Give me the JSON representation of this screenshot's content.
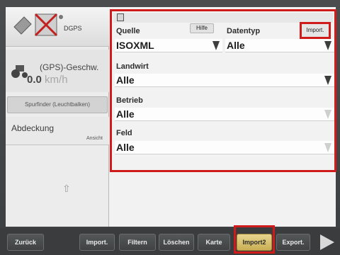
{
  "left": {
    "gps_label": "DGPS",
    "speed_title": "(GPS)-Geschw.",
    "speed_value": "0.0",
    "speed_unit": "km/h",
    "spurfinder": "Spurfinder (Leuchtbalken)",
    "abdeckung": "Abdeckung",
    "ansicht": "Ansicht"
  },
  "form": {
    "quelle_label": "Quelle",
    "quelle_value": "ISOXML",
    "hilfe_button": "Hilfe",
    "datentyp_label": "Datentyp",
    "datentyp_value": "Alle",
    "import_button": "Import.",
    "landwirt_label": "Landwirt",
    "landwirt_value": "Alle",
    "betrieb_label": "Betrieb",
    "betrieb_value": "Alle",
    "feld_label": "Feld",
    "feld_value": "Alle"
  },
  "bottom": {
    "zuruck": "Zurück",
    "import": "Import.",
    "filtern": "Filtern",
    "loschen": "Löschen",
    "karte": "Karte",
    "import2": "Import2",
    "export": "Export."
  },
  "colors": {
    "highlight_red": "#d01b1b",
    "active_gold": "#c9ae54"
  },
  "icons": {
    "status": "gps-satellite-icon",
    "speed": "tractor-icon",
    "next": "play-arrow-icon"
  }
}
